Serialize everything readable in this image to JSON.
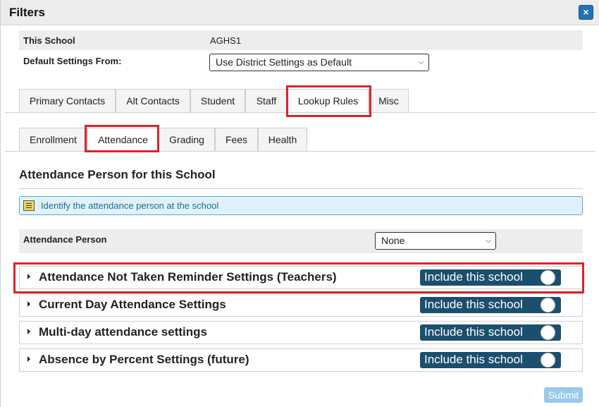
{
  "dialog": {
    "title": "Filters",
    "close_label": "×"
  },
  "school": {
    "label": "This School",
    "value": "AGHS1"
  },
  "default_settings": {
    "label": "Default Settings From:",
    "selected": "Use District Settings as Default"
  },
  "main_tabs": [
    {
      "label": "Primary Contacts"
    },
    {
      "label": "Alt Contacts"
    },
    {
      "label": "Student"
    },
    {
      "label": "Staff"
    },
    {
      "label": "Lookup Rules"
    },
    {
      "label": "Misc"
    }
  ],
  "sub_tabs": [
    {
      "label": "Enrollment"
    },
    {
      "label": "Attendance"
    },
    {
      "label": "Grading"
    },
    {
      "label": "Fees"
    },
    {
      "label": "Health"
    }
  ],
  "section": {
    "title": "Attendance Person for this School",
    "notice": "Identify the attendance person at the school"
  },
  "attendance_person": {
    "label": "Attendance Person",
    "selected": "None"
  },
  "accordions": [
    {
      "title": "Attendance Not Taken Reminder Settings (Teachers)",
      "toggle_label": "Include this school"
    },
    {
      "title": "Current Day Attendance Settings",
      "toggle_label": "Include this school"
    },
    {
      "title": "Multi-day attendance settings",
      "toggle_label": "Include this school"
    },
    {
      "title": "Absence by Percent Settings (future)",
      "toggle_label": "Include this school"
    }
  ],
  "submit_label": "Submit",
  "colors": {
    "accent": "#1f73b7",
    "toggle": "#1b4f6e",
    "highlight": "#d9242b",
    "notice_bg": "#dff2fb"
  }
}
